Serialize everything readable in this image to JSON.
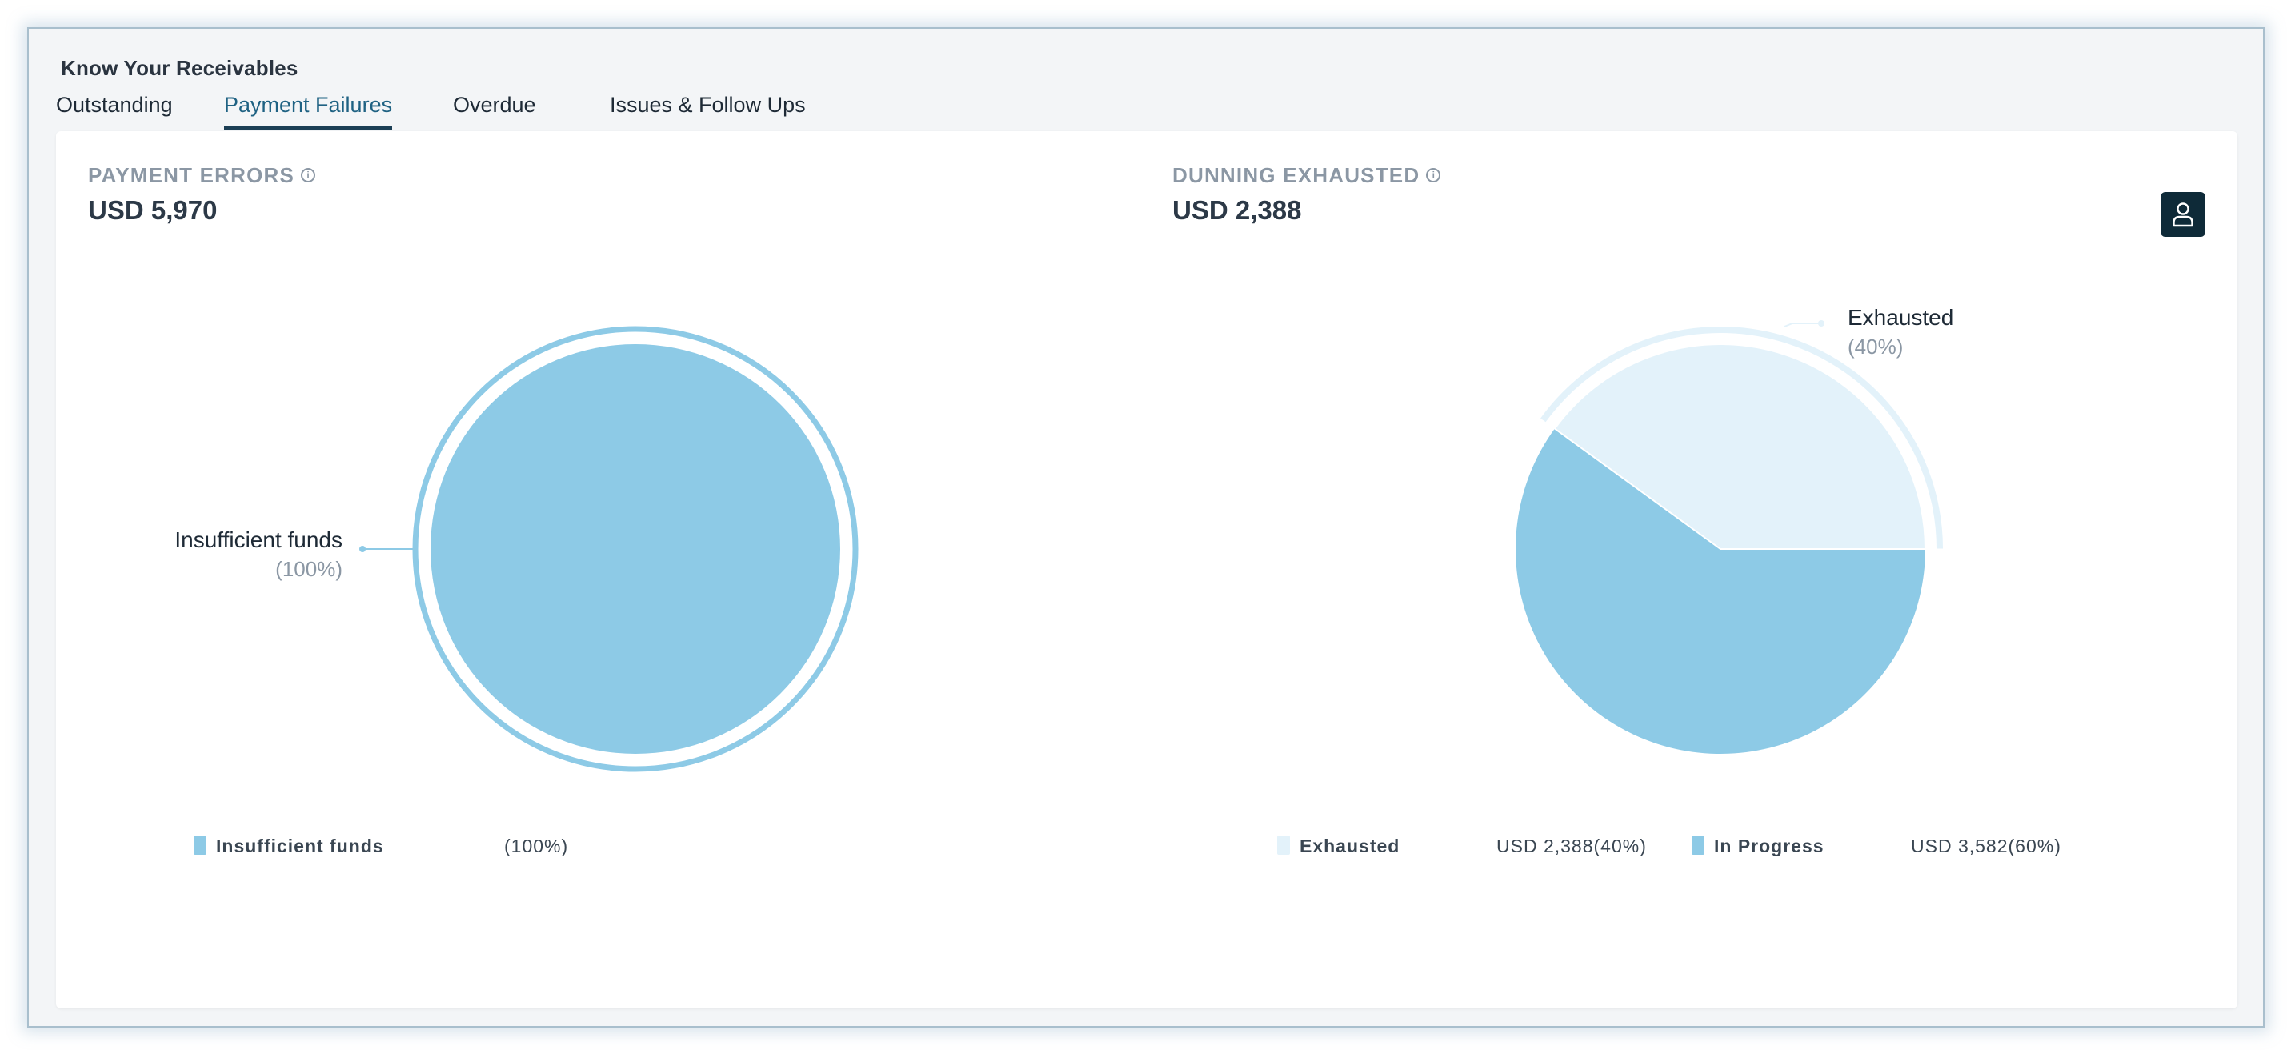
{
  "header": {
    "title": "Know Your Receivables"
  },
  "tabs": [
    {
      "label": "Outstanding",
      "active": false
    },
    {
      "label": "Payment Failures",
      "active": true
    },
    {
      "label": "Overdue",
      "active": false
    },
    {
      "label": "Issues & Follow Ups",
      "active": false
    }
  ],
  "icons": {
    "info": "info-icon",
    "user": "user-icon"
  },
  "colors": {
    "primary_slice": "#8dcae6",
    "secondary_slice": "#e3f2fa",
    "active_tab": "#1f6283",
    "user_button": "#0e2a38"
  },
  "panels": [
    {
      "title": "PAYMENT ERRORS",
      "amount": "USD 5,970",
      "legend": [
        {
          "name": "Insufficient funds",
          "value": "(100%)"
        }
      ]
    },
    {
      "title": "DUNNING EXHAUSTED",
      "amount": "USD 2,388",
      "legend": [
        {
          "name": "Exhausted",
          "value": "USD  2,388(40%)"
        },
        {
          "name": "In Progress",
          "value": "USD  3,582(60%)"
        }
      ]
    }
  ],
  "chart_data": [
    {
      "type": "pie",
      "title": "PAYMENT ERRORS",
      "categories": [
        "Insufficient funds"
      ],
      "values": [
        100
      ],
      "labels": [
        {
          "name": "Insufficient funds",
          "pct": "(100%)"
        }
      ],
      "legend": "bottom"
    },
    {
      "type": "pie",
      "title": "DUNNING EXHAUSTED",
      "categories": [
        "Exhausted",
        "In Progress"
      ],
      "values": [
        2388,
        3582
      ],
      "percent": [
        40,
        60
      ],
      "labels": [
        {
          "name": "Exhausted",
          "pct": "(40%)"
        }
      ],
      "legend": "bottom"
    }
  ]
}
